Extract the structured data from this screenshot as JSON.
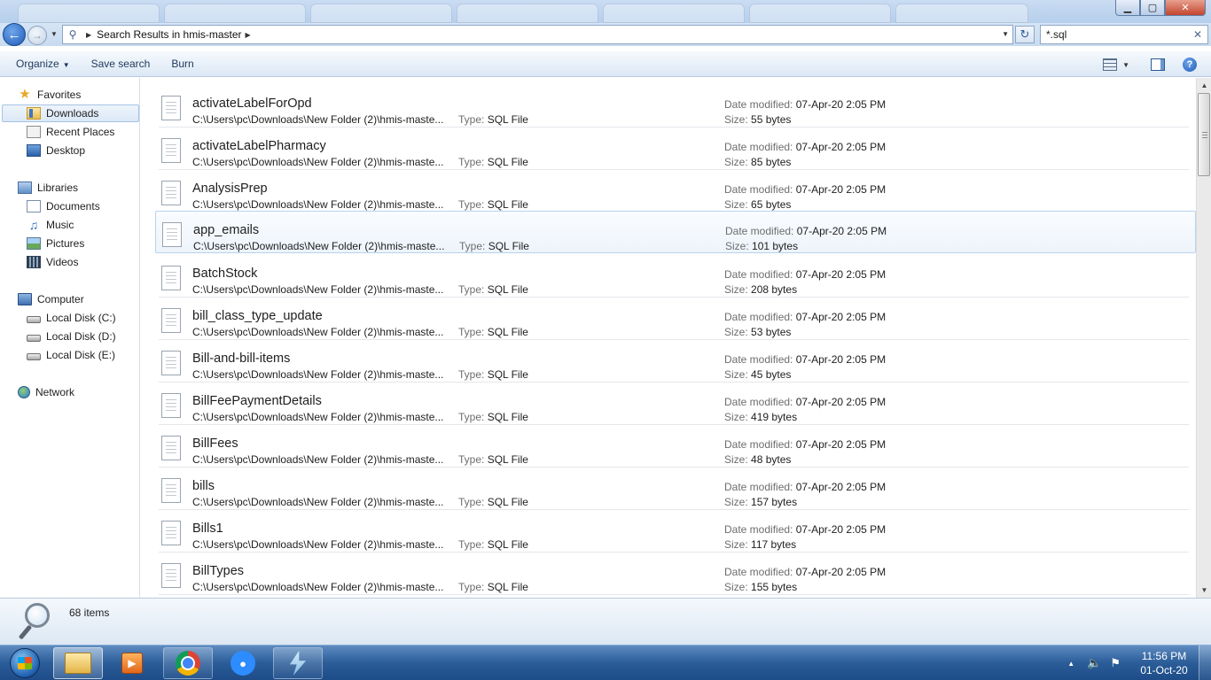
{
  "window": {
    "minimize_glyph": "▁",
    "maximize_glyph": "▢",
    "close_glyph": "✕"
  },
  "address_bar": {
    "breadcrumb": "Search Results in hmis-master",
    "search_value": "*.sql"
  },
  "toolbar": {
    "organize": "Organize",
    "save_search": "Save search",
    "burn": "Burn",
    "help_glyph": "?"
  },
  "nav": {
    "favorites": {
      "label": "Favorites",
      "icon": "star-icon"
    },
    "favorites_items": [
      {
        "label": "Downloads",
        "icon": "downloads-folder-icon",
        "selected": true
      },
      {
        "label": "Recent Places",
        "icon": "recent-places-icon"
      },
      {
        "label": "Desktop",
        "icon": "desktop-icon"
      }
    ],
    "libraries": {
      "label": "Libraries",
      "icon": "libraries-icon"
    },
    "libraries_items": [
      {
        "label": "Documents",
        "icon": "documents-icon"
      },
      {
        "label": "Music",
        "icon": "music-icon"
      },
      {
        "label": "Pictures",
        "icon": "pictures-icon"
      },
      {
        "label": "Videos",
        "icon": "videos-icon"
      }
    ],
    "computer": {
      "label": "Computer",
      "icon": "computer-icon"
    },
    "computer_items": [
      {
        "label": "Local Disk (C:)",
        "icon": "disk-icon"
      },
      {
        "label": "Local Disk (D:)",
        "icon": "disk-icon"
      },
      {
        "label": "Local Disk (E:)",
        "icon": "disk-icon"
      }
    ],
    "network": {
      "label": "Network",
      "icon": "network-icon"
    }
  },
  "labels": {
    "type": "Type:",
    "date_modified": "Date modified:",
    "size": "Size:"
  },
  "results": [
    {
      "name": "activateLabelForOpd",
      "path": "C:\\Users\\pc\\Downloads\\New Folder (2)\\hmis-maste...",
      "type": "SQL File",
      "date": "07-Apr-20 2:05 PM",
      "size": "55 bytes"
    },
    {
      "name": "activateLabelPharmacy",
      "path": "C:\\Users\\pc\\Downloads\\New Folder (2)\\hmis-maste...",
      "type": "SQL File",
      "date": "07-Apr-20 2:05 PM",
      "size": "85 bytes"
    },
    {
      "name": "AnalysisPrep",
      "path": "C:\\Users\\pc\\Downloads\\New Folder (2)\\hmis-maste...",
      "type": "SQL File",
      "date": "07-Apr-20 2:05 PM",
      "size": "65 bytes"
    },
    {
      "name": "app_emails",
      "path": "C:\\Users\\pc\\Downloads\\New Folder (2)\\hmis-maste...",
      "type": "SQL File",
      "date": "07-Apr-20 2:05 PM",
      "size": "101 bytes",
      "hover": true
    },
    {
      "name": "BatchStock",
      "path": "C:\\Users\\pc\\Downloads\\New Folder (2)\\hmis-maste...",
      "type": "SQL File",
      "date": "07-Apr-20 2:05 PM",
      "size": "208 bytes"
    },
    {
      "name": "bill_class_type_update",
      "path": "C:\\Users\\pc\\Downloads\\New Folder (2)\\hmis-maste...",
      "type": "SQL File",
      "date": "07-Apr-20 2:05 PM",
      "size": "53 bytes"
    },
    {
      "name": "Bill-and-bill-items",
      "path": "C:\\Users\\pc\\Downloads\\New Folder (2)\\hmis-maste...",
      "type": "SQL File",
      "date": "07-Apr-20 2:05 PM",
      "size": "45 bytes"
    },
    {
      "name": "BillFeePaymentDetails",
      "path": "C:\\Users\\pc\\Downloads\\New Folder (2)\\hmis-maste...",
      "type": "SQL File",
      "date": "07-Apr-20 2:05 PM",
      "size": "419 bytes"
    },
    {
      "name": "BillFees",
      "path": "C:\\Users\\pc\\Downloads\\New Folder (2)\\hmis-maste...",
      "type": "SQL File",
      "date": "07-Apr-20 2:05 PM",
      "size": "48 bytes"
    },
    {
      "name": "bills",
      "path": "C:\\Users\\pc\\Downloads\\New Folder (2)\\hmis-maste...",
      "type": "SQL File",
      "date": "07-Apr-20 2:05 PM",
      "size": "157 bytes"
    },
    {
      "name": "Bills1",
      "path": "C:\\Users\\pc\\Downloads\\New Folder (2)\\hmis-maste...",
      "type": "SQL File",
      "date": "07-Apr-20 2:05 PM",
      "size": "117 bytes"
    },
    {
      "name": "BillTypes",
      "path": "C:\\Users\\pc\\Downloads\\New Folder (2)\\hmis-maste...",
      "type": "SQL File",
      "date": "07-Apr-20 2:05 PM",
      "size": "155 bytes"
    }
  ],
  "status": {
    "item_count": "68 items"
  },
  "taskbar": {
    "apps": [
      {
        "name": "windows-explorer",
        "icon": "explorer-folder-icon"
      },
      {
        "name": "media-player",
        "icon": "media-player-icon"
      },
      {
        "name": "google-chrome",
        "icon": "chrome-icon"
      },
      {
        "name": "zoom",
        "icon": "zoom-icon"
      },
      {
        "name": "app-bolt",
        "icon": "bolt-icon"
      }
    ],
    "time": "11:56 PM",
    "date": "01-Oct-20"
  }
}
